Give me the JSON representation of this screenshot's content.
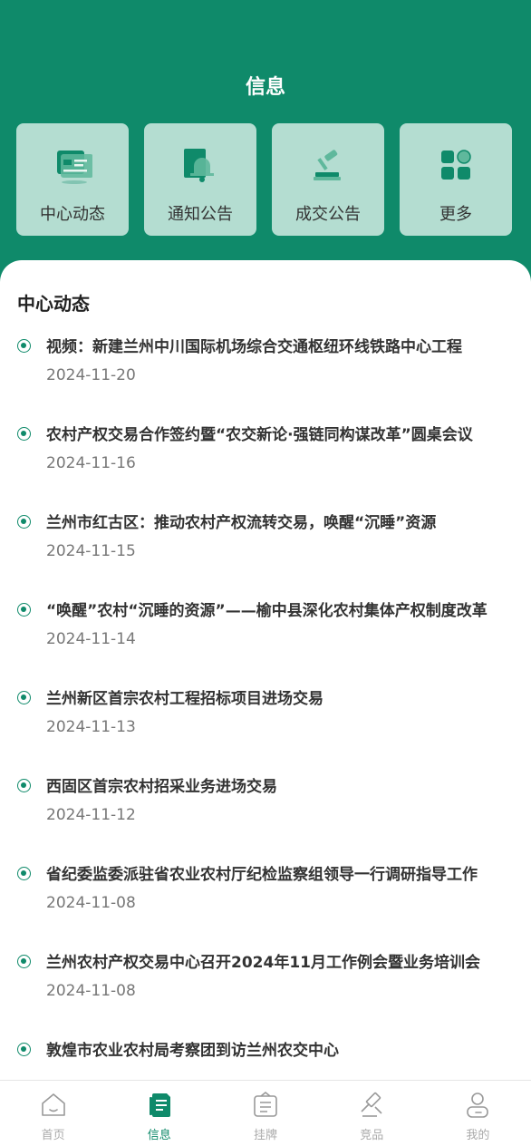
{
  "header": {
    "title": "信息"
  },
  "categories": [
    {
      "label": "中心动态",
      "icon": "news-icon"
    },
    {
      "label": "通知公告",
      "icon": "bell-icon"
    },
    {
      "label": "成交公告",
      "icon": "gavel-icon"
    },
    {
      "label": "更多",
      "icon": "grid-icon"
    }
  ],
  "section": {
    "title": "中心动态"
  },
  "news": [
    {
      "title": "视频：新建兰州中川国际机场综合交通枢纽环线铁路中心工程",
      "date": "2024-11-20"
    },
    {
      "title": "农村产权交易合作签约暨“农交新论·强链同构谋改革”圆桌会议",
      "date": "2024-11-16"
    },
    {
      "title": "兰州市红古区：推动农村产权流转交易，唤醒“沉睡”资源",
      "date": "2024-11-15"
    },
    {
      "title": "“唤醒”农村“沉睡的资源”——榆中县深化农村集体产权制度改革",
      "date": "2024-11-14"
    },
    {
      "title": "兰州新区首宗农村工程招标项目进场交易",
      "date": "2024-11-13"
    },
    {
      "title": "西固区首宗农村招采业务进场交易",
      "date": "2024-11-12"
    },
    {
      "title": "省纪委监委派驻省农业农村厅纪检监察组领导一行调研指导工作",
      "date": "2024-11-08"
    },
    {
      "title": "兰州农村产权交易中心召开2024年11月工作例会暨业务培训会",
      "date": "2024-11-08"
    },
    {
      "title": "敦煌市农业农村局考察团到访兰州农交中心",
      "date": ""
    }
  ],
  "tabbar": [
    {
      "label": "首页",
      "icon": "home-icon"
    },
    {
      "label": "信息",
      "icon": "document-icon",
      "active": true
    },
    {
      "label": "挂牌",
      "icon": "listing-icon"
    },
    {
      "label": "竞品",
      "icon": "gavel-icon"
    },
    {
      "label": "我的",
      "icon": "user-icon"
    }
  ],
  "colors": {
    "primary": "#0f8a6a",
    "tile": "#b4ddd1"
  }
}
